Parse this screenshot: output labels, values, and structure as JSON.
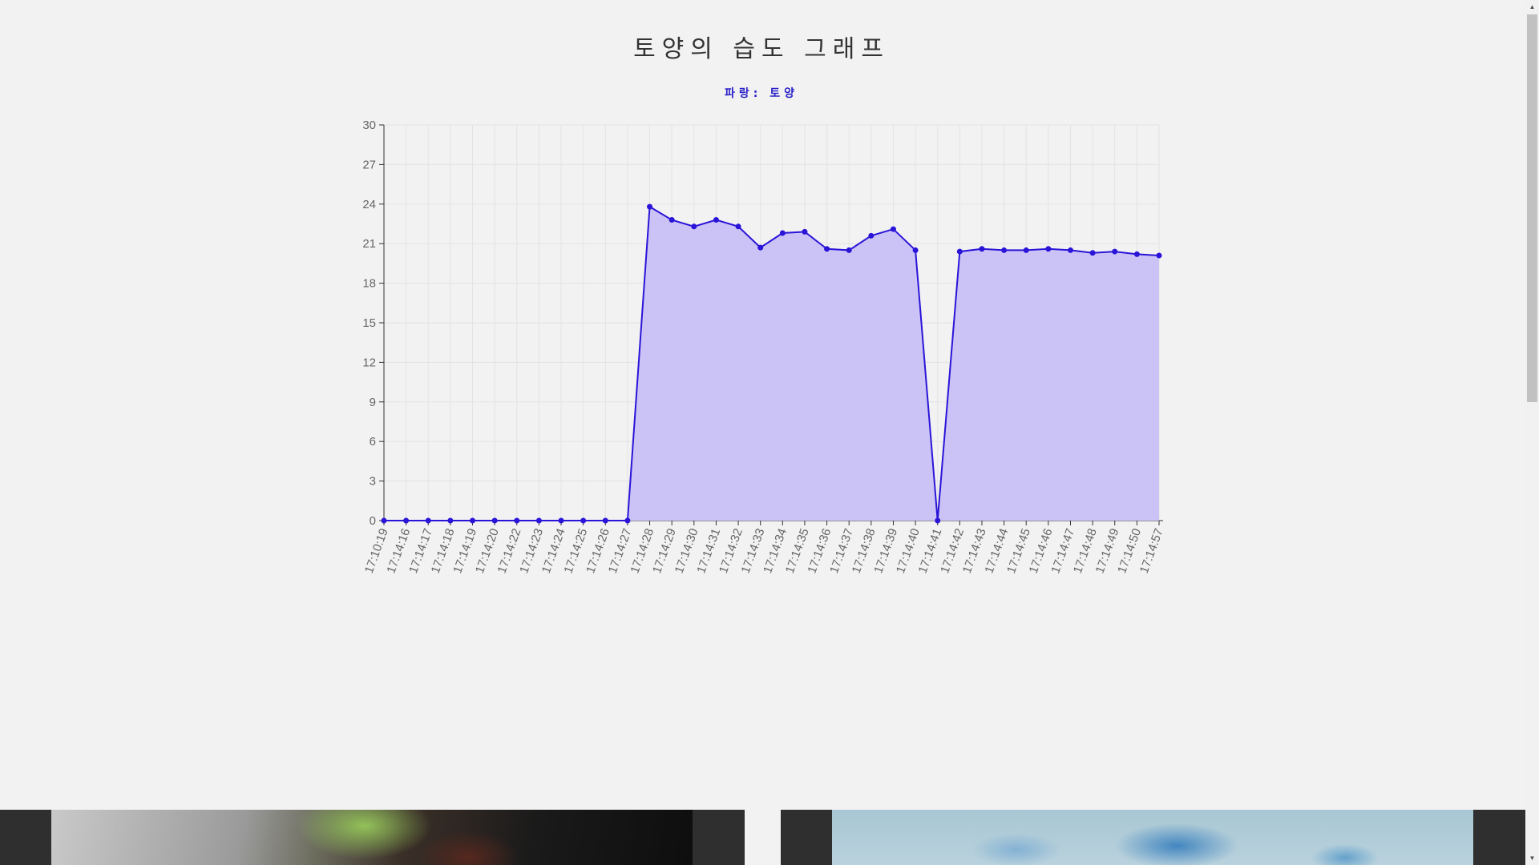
{
  "page": {
    "title": "토양의 습도 그래프",
    "legend_label": "파랑: 토양"
  },
  "colors": {
    "line": "#2a14d8",
    "fill": "#cbc3f5",
    "grid": "#e3e3e3",
    "axis": "#333333",
    "tick_text": "#666666",
    "background": "#f2f2f2"
  },
  "chart_data": {
    "type": "area",
    "title": "",
    "xlabel": "",
    "ylabel": "",
    "ylim": [
      0,
      30
    ],
    "y_ticks": [
      0,
      3,
      6,
      9,
      12,
      15,
      18,
      21,
      24,
      27,
      30
    ],
    "grid": true,
    "x": [
      "17:10:19",
      "17:14:16",
      "17:14:17",
      "17:14:18",
      "17:14:19",
      "17:14:20",
      "17:14:22",
      "17:14:23",
      "17:14:24",
      "17:14:25",
      "17:14:26",
      "17:14:27",
      "17:14:28",
      "17:14:29",
      "17:14:30",
      "17:14:31",
      "17:14:32",
      "17:14:33",
      "17:14:34",
      "17:14:35",
      "17:14:36",
      "17:14:37",
      "17:14:38",
      "17:14:39",
      "17:14:40",
      "17:14:41",
      "17:14:42",
      "17:14:43",
      "17:14:44",
      "17:14:45",
      "17:14:46",
      "17:14:47",
      "17:14:48",
      "17:14:49",
      "17:14:50",
      "17:14:57"
    ],
    "series": [
      {
        "name": "토양",
        "values": [
          0,
          0,
          0,
          0,
          0,
          0,
          0,
          0,
          0,
          0,
          0,
          0,
          23.8,
          22.8,
          22.3,
          22.8,
          22.3,
          20.7,
          21.8,
          21.9,
          20.6,
          20.5,
          21.6,
          22.1,
          20.5,
          0,
          20.4,
          20.6,
          20.5,
          20.5,
          20.6,
          20.5,
          20.3,
          20.4,
          20.2,
          20.1
        ]
      }
    ]
  },
  "bottom_panels": [
    {
      "photo_icon": "thermometer-plant-photo"
    },
    {
      "photo_icon": "sky-clouds-photo"
    }
  ]
}
